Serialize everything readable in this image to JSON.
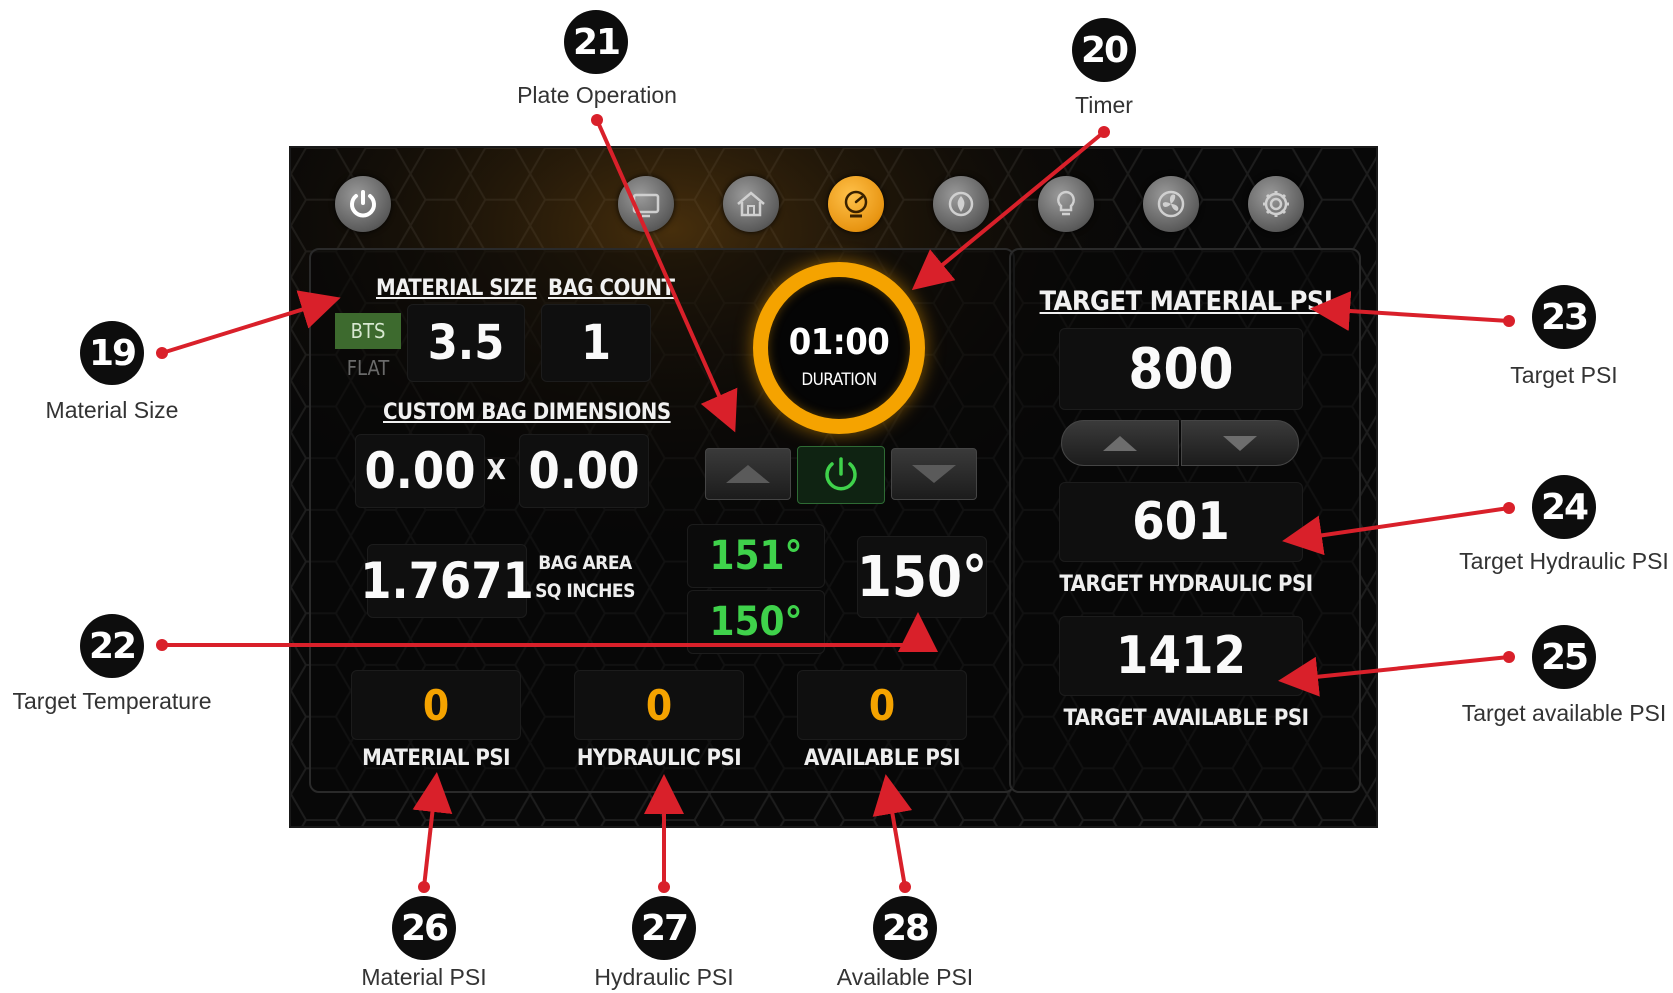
{
  "nav": {
    "items": [
      {
        "icon": "power-icon"
      },
      {
        "icon": "monitor-icon"
      },
      {
        "icon": "home-icon"
      },
      {
        "icon": "gauge-icon",
        "active": true
      },
      {
        "icon": "flame-icon"
      },
      {
        "icon": "bulb-icon"
      },
      {
        "icon": "fan-icon"
      },
      {
        "icon": "gear-icon"
      }
    ]
  },
  "material": {
    "size_title": "MATERIAL SIZE",
    "count_title": "BAG COUNT",
    "toggle_bts": "BTS",
    "toggle_flat": "FLAT",
    "size_value": "3.5",
    "count_value": "1",
    "custom_title": "CUSTOM BAG DIMENSIONS",
    "dim_x": "0.00",
    "dim_sep": "X",
    "dim_y": "0.00",
    "area_value": "1.7671",
    "area_label_1": "BAG AREA",
    "area_label_2": "SQ INCHES"
  },
  "timer": {
    "value": "01:00",
    "label": "DURATION"
  },
  "temperature": {
    "top_plate": "151°",
    "bottom_plate": "150°",
    "target": "150°"
  },
  "pressure_readouts": [
    {
      "value": "0",
      "label": "MATERIAL PSI"
    },
    {
      "value": "0",
      "label": "HYDRAULIC PSI"
    },
    {
      "value": "0",
      "label": "AVAILABLE PSI"
    }
  ],
  "targets": {
    "material_title": "TARGET MATERIAL PSI",
    "material_value": "800",
    "hydraulic_value": "601",
    "hydraulic_label": "TARGET HYDRAULIC PSI",
    "available_value": "1412",
    "available_label": "TARGET AVAILABLE PSI"
  },
  "callouts": {
    "c19": {
      "num": "19",
      "label": "Material Size"
    },
    "c20": {
      "num": "20",
      "label": "Timer"
    },
    "c21": {
      "num": "21",
      "label": "Plate Operation"
    },
    "c22": {
      "num": "22",
      "label": "Target Temperature"
    },
    "c23": {
      "num": "23",
      "label": "Target PSI"
    },
    "c24": {
      "num": "24",
      "label": "Target Hydraulic PSI"
    },
    "c25": {
      "num": "25",
      "label": "Target available PSI"
    },
    "c26": {
      "num": "26",
      "label": "Material PSI"
    },
    "c27": {
      "num": "27",
      "label": "Hydraulic PSI"
    },
    "c28": {
      "num": "28",
      "label": "Available PSI"
    }
  },
  "colors": {
    "accent_orange": "#f5a300",
    "green_on": "#3fd24b",
    "arrow_red": "#d9202a"
  }
}
